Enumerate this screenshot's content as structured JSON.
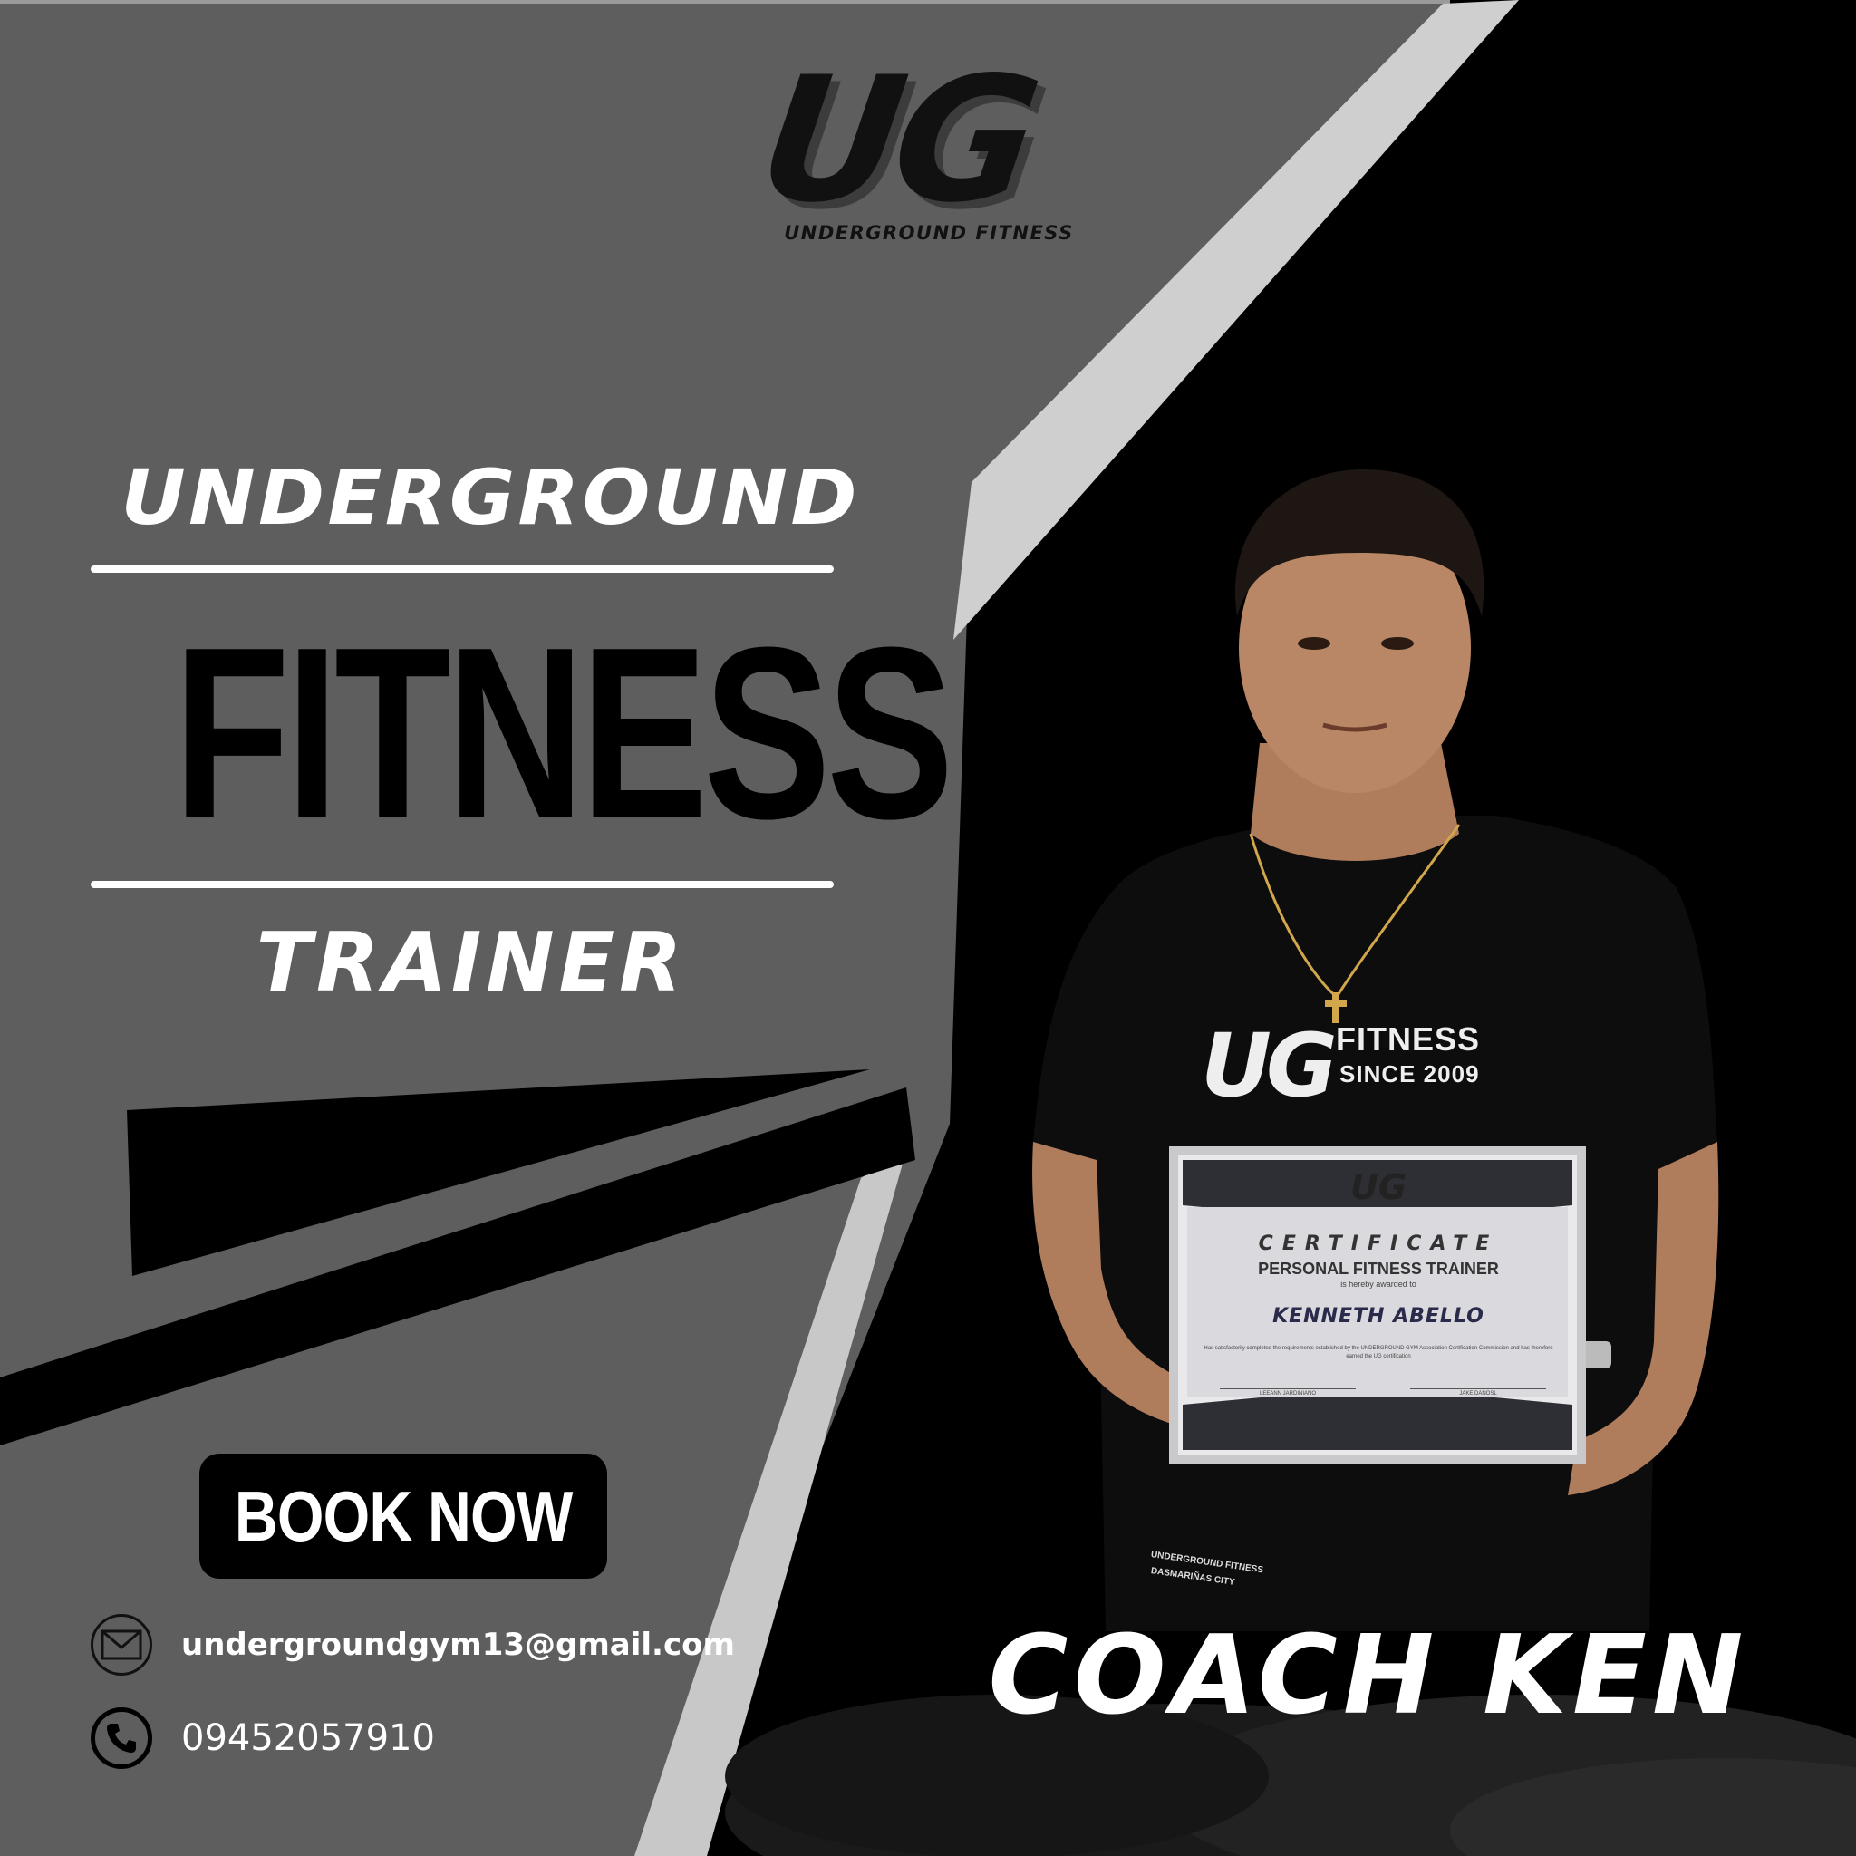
{
  "brand": {
    "logo_mark": "UG",
    "logo_subtitle": "UNDERGROUND FITNESS"
  },
  "headline": {
    "line1": "UNDERGROUND",
    "line2": "FITNESS",
    "line3": "TRAINER"
  },
  "cta": {
    "book_label": "BOOK NOW"
  },
  "contact": {
    "email": "undergroundgym13@gmail.com",
    "phone": "09452057910",
    "email_icon": "mail-icon",
    "phone_icon": "phone-icon"
  },
  "coach": {
    "name": "COACH KEN"
  },
  "shirt": {
    "logo": "UG",
    "fitness": "FITNESS",
    "since": "SINCE 2009",
    "bottom_line1": "UNDERGROUND FITNESS",
    "bottom_line2": "DASMARIÑAS CITY"
  },
  "certificate": {
    "logo": "UG",
    "title": "CERTIFICATE",
    "subtitle": "PERSONAL FITNESS TRAINER",
    "awarded": "is hereby awarded to",
    "recipient": "KENNETH ABELLO",
    "description": "Has satisfactorily completed the requirements established by the UNDERGROUND GYM Association Certification Commission and has therefore earned the UG certification",
    "signatory_left": "LEEANN JARDINIANO",
    "signatory_right": "JAKE DANOSL"
  },
  "colors": {
    "panel_gray": "#5e5e5e",
    "stripe_light": "#c8c8c8",
    "background_black": "#000000",
    "text_white": "#ffffff"
  }
}
